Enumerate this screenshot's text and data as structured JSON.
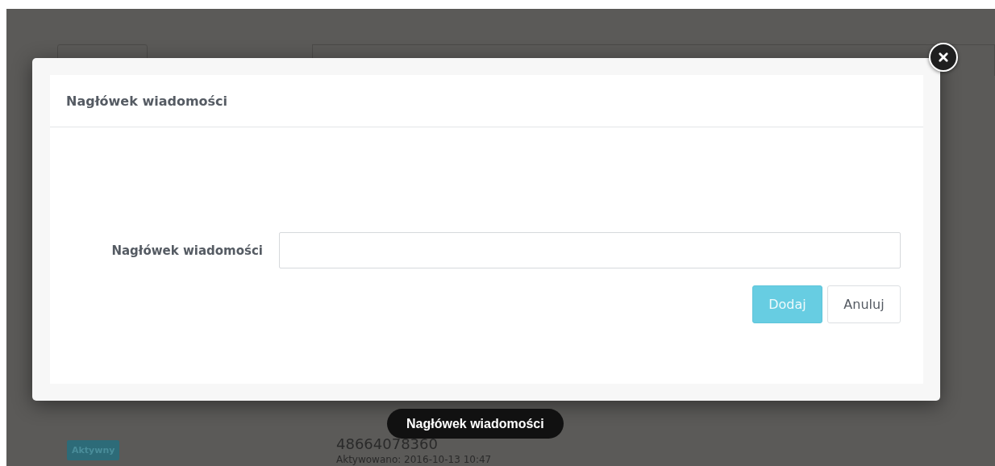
{
  "background": {
    "status_badge": "Aktywny",
    "number": "48664078360",
    "activated": "Aktywowano: 2016-10-13 10:47"
  },
  "modal": {
    "title": "Nagłówek wiadomości",
    "field": {
      "label": "Nagłówek wiadomości"
    },
    "buttons": [
      {
        "label": "Dodaj",
        "kind": "primary"
      },
      {
        "label": "Anuluj",
        "kind": "default"
      }
    ]
  },
  "tooltip": "Nagłówek wiadomości"
}
